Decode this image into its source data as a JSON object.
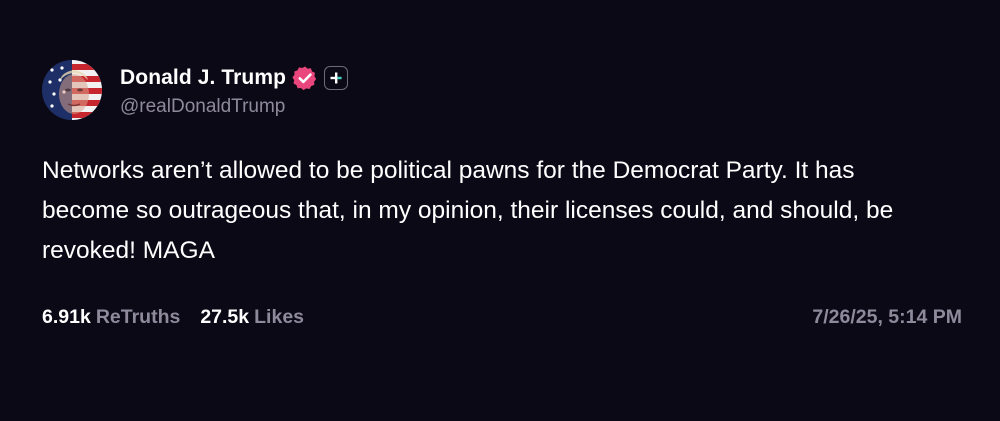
{
  "post": {
    "author": {
      "display_name": "Donald J. Trump",
      "handle": "@realDonaldTrump",
      "verified_icon": "verified-badge-icon",
      "plus_icon": "plus-badge-icon"
    },
    "text": "Networks aren’t allowed to be political pawns for the Democrat Party. It has become so outrageous that, in my opinion, their licenses could, and should, be revoked! MAGA",
    "stats": {
      "retruths_count": "6.91k",
      "retruths_label": "ReTruths",
      "likes_count": "27.5k",
      "likes_label": "Likes"
    },
    "timestamp": "7/26/25, 5:14 PM"
  },
  "colors": {
    "background": "#0c0916",
    "text_primary": "#ffffff",
    "text_secondary": "#8e8a9c",
    "verified_badge": "#e8467c"
  }
}
